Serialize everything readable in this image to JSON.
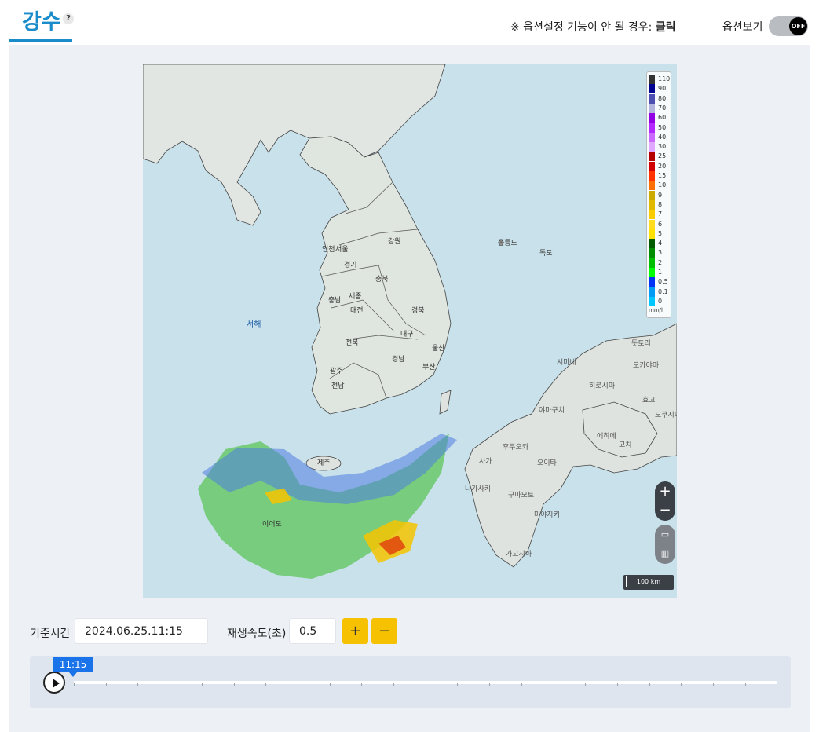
{
  "header": {
    "title": "강수",
    "help_label": "?",
    "option_note_prefix": "※ 옵션설정 기능이 안 될 경우: ",
    "option_note_link": "클릭",
    "option_view_label": "옵션보기",
    "toggle_state": "OFF",
    "accent_color": "#1a8cc9"
  },
  "map": {
    "labels_korea": [
      "강원",
      "울릉도",
      "독도",
      "인천",
      "서울",
      "경기",
      "충북",
      "충남",
      "세종",
      "대전",
      "경북",
      "대구",
      "울산",
      "전북",
      "경남",
      "부산",
      "광주",
      "전남",
      "제주"
    ],
    "labels_japan": [
      "시마네",
      "히로시마",
      "야마구치",
      "후쿠오카",
      "사가",
      "오이타",
      "나가사키",
      "구마모토",
      "미야자키",
      "가고시마",
      "돗토리",
      "오카야마",
      "효고",
      "도쿠시마",
      "에히메",
      "고치"
    ],
    "label_sea": "서해",
    "label_ieodo": "이어도",
    "zoom_in": "+",
    "zoom_out": "−",
    "ruler_icon": "ruler-icon",
    "layers_icon": "map-layers-icon",
    "scale_label": "100 km"
  },
  "legend": {
    "unit": "mm/h",
    "items": [
      {
        "value": "110",
        "color": "#333333"
      },
      {
        "value": "90",
        "color": "#000390"
      },
      {
        "value": "80",
        "color": "#4c4eb1"
      },
      {
        "value": "70",
        "color": "#b3b4de"
      },
      {
        "value": "60",
        "color": "#9300e4"
      },
      {
        "value": "50",
        "color": "#b329ff"
      },
      {
        "value": "40",
        "color": "#c969ff"
      },
      {
        "value": "30",
        "color": "#e0a9ff"
      },
      {
        "value": "25",
        "color": "#b40000"
      },
      {
        "value": "20",
        "color": "#d20000"
      },
      {
        "value": "15",
        "color": "#ff3200"
      },
      {
        "value": "10",
        "color": "#ff6e00"
      },
      {
        "value": "9",
        "color": "#ccaa00"
      },
      {
        "value": "8",
        "color": "#e0b900"
      },
      {
        "value": "7",
        "color": "#f9cd00"
      },
      {
        "value": "6",
        "color": "#ffdc1f"
      },
      {
        "value": "5",
        "color": "#ffe100"
      },
      {
        "value": "4",
        "color": "#005a00"
      },
      {
        "value": "3",
        "color": "#008c00"
      },
      {
        "value": "2",
        "color": "#00be00"
      },
      {
        "value": "1",
        "color": "#00ff00"
      },
      {
        "value": "0.5",
        "color": "#0033f5"
      },
      {
        "value": "0.1",
        "color": "#009bf5"
      },
      {
        "value": "0",
        "color": "#00c8ff"
      }
    ]
  },
  "controls": {
    "base_time_label": "기준시간",
    "base_time_value": "2024.06.25.11:15",
    "speed_label": "재생속도(초)",
    "speed_value": "0.5",
    "plus_label": "+",
    "minus_label": "−"
  },
  "timeline": {
    "current_time": "11:15",
    "play_icon": "play-icon"
  }
}
